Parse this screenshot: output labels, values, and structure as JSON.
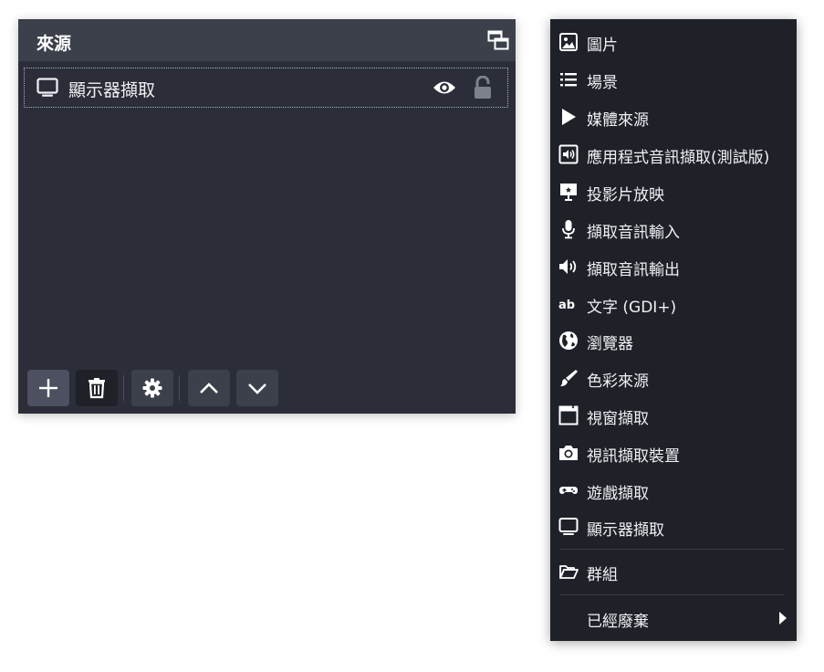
{
  "sources_panel": {
    "title": "來源",
    "sources": [
      {
        "label": "顯示器擷取",
        "icon": "monitor-icon",
        "visible": true,
        "locked": false
      }
    ],
    "toolbar": [
      {
        "icon": "plus-icon"
      },
      {
        "icon": "trash-icon"
      },
      {
        "icon": "gear-icon"
      },
      {
        "icon": "chevron-up-icon"
      },
      {
        "icon": "chevron-down-icon"
      }
    ]
  },
  "context_menu": {
    "items": [
      {
        "label": "圖片",
        "icon": "image-icon"
      },
      {
        "label": "場景",
        "icon": "list-icon"
      },
      {
        "label": "媒體來源",
        "icon": "play-icon"
      },
      {
        "label": "應用程式音訊擷取(測試版)",
        "icon": "app-audio-icon"
      },
      {
        "label": "投影片放映",
        "icon": "slideshow-icon"
      },
      {
        "label": "擷取音訊輸入",
        "icon": "microphone-icon"
      },
      {
        "label": "擷取音訊輸出",
        "icon": "speaker-icon"
      },
      {
        "label": "文字 (GDI+)",
        "icon": "text-ab-icon"
      },
      {
        "label": "瀏覽器",
        "icon": "globe-icon"
      },
      {
        "label": "色彩來源",
        "icon": "brush-icon"
      },
      {
        "label": "視窗擷取",
        "icon": "window-icon"
      },
      {
        "label": "視訊擷取裝置",
        "icon": "camera-icon"
      },
      {
        "label": "遊戲擷取",
        "icon": "gamepad-icon"
      },
      {
        "label": "顯示器擷取",
        "icon": "monitor-icon"
      }
    ],
    "group": {
      "label": "群組",
      "icon": "folder-open-icon"
    },
    "deprecated": {
      "label": "已經廢棄",
      "icon": "caret-right-icon"
    }
  }
}
